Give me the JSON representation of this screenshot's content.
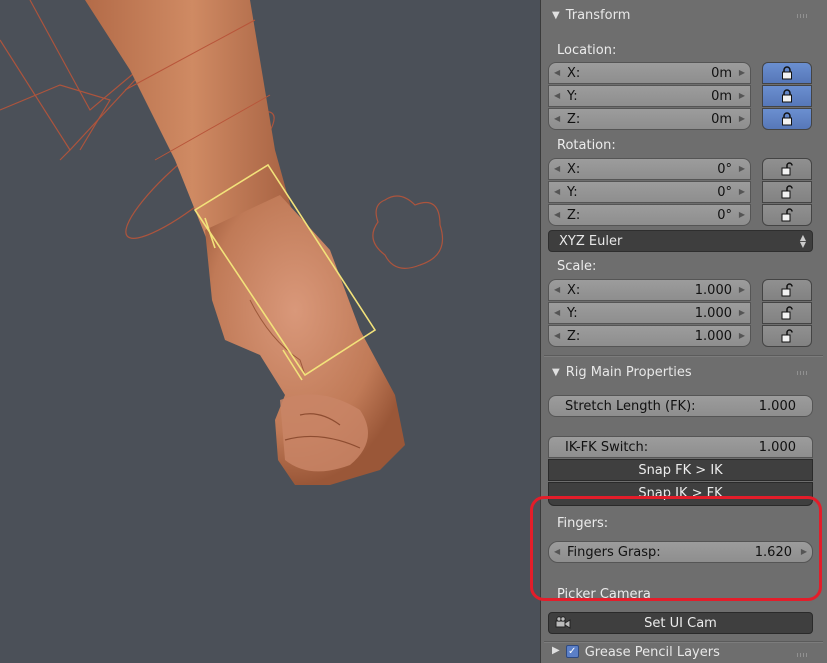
{
  "transform": {
    "header": "Transform",
    "location": {
      "label": "Location:",
      "fields": [
        {
          "axis": "X:",
          "value": "0m",
          "locked": true
        },
        {
          "axis": "Y:",
          "value": "0m",
          "locked": true
        },
        {
          "axis": "Z:",
          "value": "0m",
          "locked": true
        }
      ]
    },
    "rotation": {
      "label": "Rotation:",
      "fields": [
        {
          "axis": "X:",
          "value": "0°",
          "locked": false
        },
        {
          "axis": "Y:",
          "value": "0°",
          "locked": false
        },
        {
          "axis": "Z:",
          "value": "0°",
          "locked": false
        }
      ],
      "mode": "XYZ Euler"
    },
    "scale": {
      "label": "Scale:",
      "fields": [
        {
          "axis": "X:",
          "value": "1.000",
          "locked": false
        },
        {
          "axis": "Y:",
          "value": "1.000",
          "locked": false
        },
        {
          "axis": "Z:",
          "value": "1.000",
          "locked": false
        }
      ]
    }
  },
  "rig": {
    "header": "Rig Main Properties",
    "stretch": {
      "label": "Stretch Length (FK):",
      "value": "1.000"
    },
    "ikfk": {
      "label": "IK-FK Switch:",
      "value": "1.000"
    },
    "snap_fk_ik": "Snap FK > IK",
    "snap_ik_fk": "Snap IK > FK",
    "fingers_label": "Fingers:",
    "fingers_grasp": {
      "label": "Fingers Grasp:",
      "value": "1.620"
    },
    "picker_label": "Picker Camera",
    "set_ui_cam": "Set UI Cam"
  },
  "grease": {
    "header": "Grease Pencil Layers",
    "enabled": true
  },
  "colors": {
    "accent_lock": "#5b7fc7",
    "highlight": "#e31d2a",
    "selection": "#f2e27a",
    "wire": "#c0553a"
  }
}
